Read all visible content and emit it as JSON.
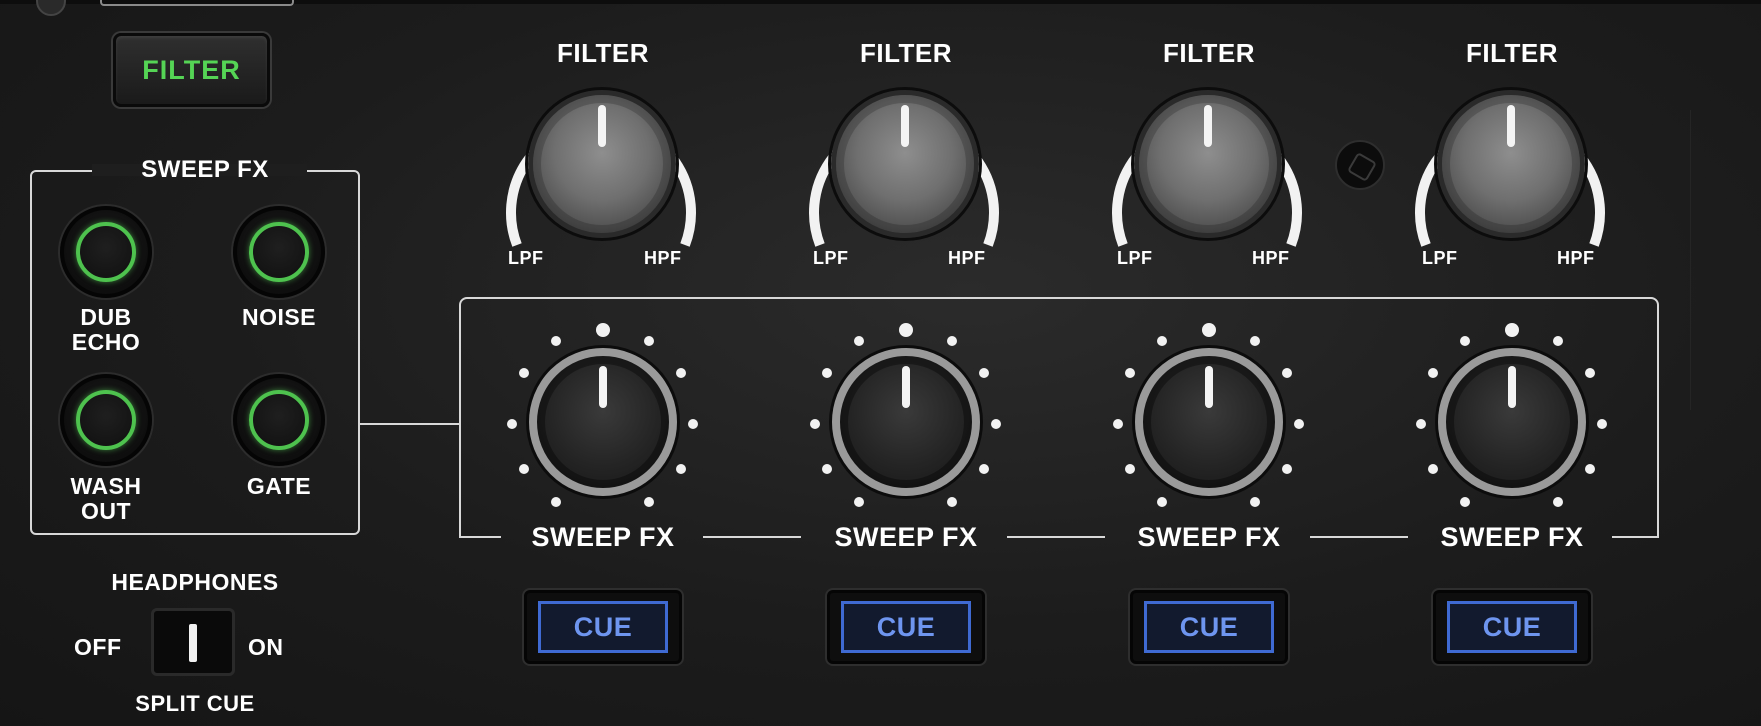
{
  "mixer": {
    "filter_mode_button": "FILTER",
    "sweep_fx_section": {
      "title": "SWEEP FX",
      "buttons": [
        {
          "label_line1": "DUB",
          "label_line2": "ECHO"
        },
        {
          "label_line1": "NOISE",
          "label_line2": ""
        },
        {
          "label_line1": "WASH",
          "label_line2": "OUT"
        },
        {
          "label_line1": "GATE",
          "label_line2": ""
        }
      ],
      "accent_color": "#4ec24e"
    },
    "channels": [
      {
        "filter_label": "FILTER",
        "lpf_label": "LPF",
        "hpf_label": "HPF",
        "sweep_label": "SWEEP FX",
        "cue_label": "CUE"
      },
      {
        "filter_label": "FILTER",
        "lpf_label": "LPF",
        "hpf_label": "HPF",
        "sweep_label": "SWEEP FX",
        "cue_label": "CUE"
      },
      {
        "filter_label": "FILTER",
        "lpf_label": "LPF",
        "hpf_label": "HPF",
        "sweep_label": "SWEEP FX",
        "cue_label": "CUE"
      },
      {
        "filter_label": "FILTER",
        "lpf_label": "LPF",
        "hpf_label": "HPF",
        "sweep_label": "SWEEP FX",
        "cue_label": "CUE"
      }
    ],
    "cue_color": "#3f6ad2",
    "headphones": {
      "title": "HEADPHONES",
      "off_label": "OFF",
      "on_label": "ON",
      "split_label": "SPLIT CUE"
    }
  }
}
